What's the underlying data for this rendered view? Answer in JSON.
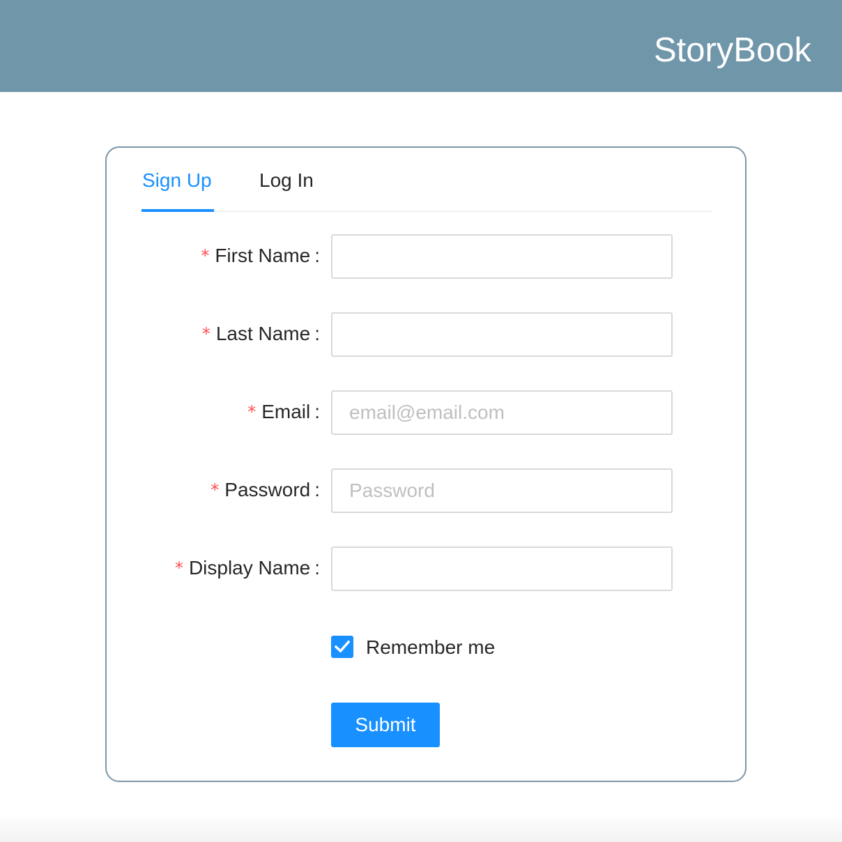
{
  "header": {
    "title": "StoryBook",
    "background_color": "#7096aa"
  },
  "tabs": [
    {
      "label": "Sign Up",
      "active": true
    },
    {
      "label": "Log In",
      "active": false
    }
  ],
  "form": {
    "fields": [
      {
        "label": "First Name",
        "required": true,
        "value": "",
        "placeholder": ""
      },
      {
        "label": "Last Name",
        "required": true,
        "value": "",
        "placeholder": ""
      },
      {
        "label": "Email",
        "required": true,
        "value": "",
        "placeholder": "email@email.com"
      },
      {
        "label": "Password",
        "required": true,
        "value": "",
        "placeholder": "Password"
      },
      {
        "label": "Display Name",
        "required": true,
        "value": "",
        "placeholder": ""
      }
    ],
    "required_mark": "*",
    "label_suffix": ":",
    "remember_me": {
      "label": "Remember me",
      "checked": true,
      "icon": "checkmark-icon"
    },
    "submit_label": "Submit"
  },
  "colors": {
    "accent": "#1890ff",
    "required": "#ff4d4f",
    "card_border": "#7a96a8"
  }
}
